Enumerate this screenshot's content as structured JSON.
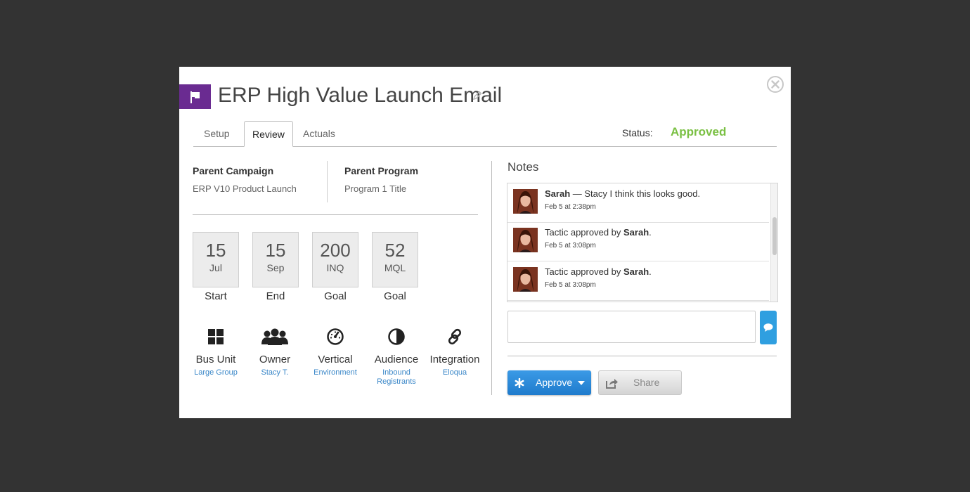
{
  "header": {
    "title": "ERP High Value Launch Email",
    "icon": "flag-icon",
    "accent_color": "#6a2b91"
  },
  "tabs": [
    {
      "label": "Setup",
      "active": false
    },
    {
      "label": "Review",
      "active": true
    },
    {
      "label": "Actuals",
      "active": false
    }
  ],
  "status": {
    "label": "Status:",
    "value": "Approved",
    "color": "#7ac043"
  },
  "parents": {
    "campaign": {
      "label": "Parent Campaign",
      "value": "ERP V10 Product Launch"
    },
    "program": {
      "label": "Parent Program",
      "value": "Program 1 Title"
    }
  },
  "tiles": [
    {
      "number": "15",
      "unit": "Jul",
      "label": "Start"
    },
    {
      "number": "15",
      "unit": "Sep",
      "label": "End"
    },
    {
      "number": "200",
      "unit": "INQ",
      "label": "Goal"
    },
    {
      "number": "52",
      "unit": "MQL",
      "label": "Goal"
    }
  ],
  "meta": [
    {
      "icon": "grid-icon",
      "label": "Bus Unit",
      "value": "Large Group"
    },
    {
      "icon": "users-icon",
      "label": "Owner",
      "value": "Stacy T."
    },
    {
      "icon": "dashboard-icon",
      "label": "Vertical",
      "value": "Environment"
    },
    {
      "icon": "contrast-icon",
      "label": "Audience",
      "value": "Inbound Registrants"
    },
    {
      "icon": "link-icon",
      "label": "Integration",
      "value": "Eloqua"
    }
  ],
  "notes": {
    "title": "Notes",
    "items": [
      {
        "author": "Sarah",
        "pre": "",
        "text": " — Stacy I think this looks good.",
        "post": "",
        "timestamp": "Feb 5 at 2:38pm"
      },
      {
        "author": "Sarah",
        "pre": "Tactic approved by ",
        "text": "",
        "post": ".",
        "timestamp": "Feb 5 at 3:08pm"
      },
      {
        "author": "Sarah",
        "pre": "Tactic approved by ",
        "text": "",
        "post": ".",
        "timestamp": "Feb 5 at 3:08pm"
      }
    ],
    "input_value": ""
  },
  "actions": {
    "approve_label": "Approve",
    "share_label": "Share",
    "approve_color": "#2b8ad9"
  }
}
